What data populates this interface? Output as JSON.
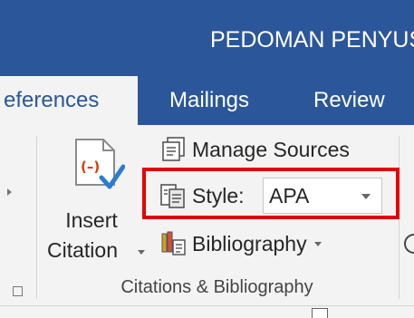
{
  "window": {
    "title": "PEDOMAN PENYUS"
  },
  "tabs": [
    {
      "label": "eferences",
      "active": true
    },
    {
      "label": "Mailings",
      "active": false
    },
    {
      "label": "Review",
      "active": false
    }
  ],
  "ribbon": {
    "insert_citation": {
      "line1": "Insert",
      "line2": "Citation",
      "icon": "insert-citation-icon",
      "icon_glyph": "(–)"
    },
    "manage_sources": {
      "label": "Manage Sources",
      "icon": "manage-sources-icon"
    },
    "style": {
      "label": "Style:",
      "value": "APA",
      "icon": "style-icon"
    },
    "bibliography": {
      "label": "Bibliography",
      "icon": "bibliography-icon"
    },
    "group_label": "Citations & Bibliography"
  },
  "colors": {
    "title_bar": "#2b579a",
    "ribbon_bg": "#f3f3f3",
    "highlight": "#e50000",
    "citation_red": "#d83b01",
    "check_blue": "#2b7cd3"
  }
}
